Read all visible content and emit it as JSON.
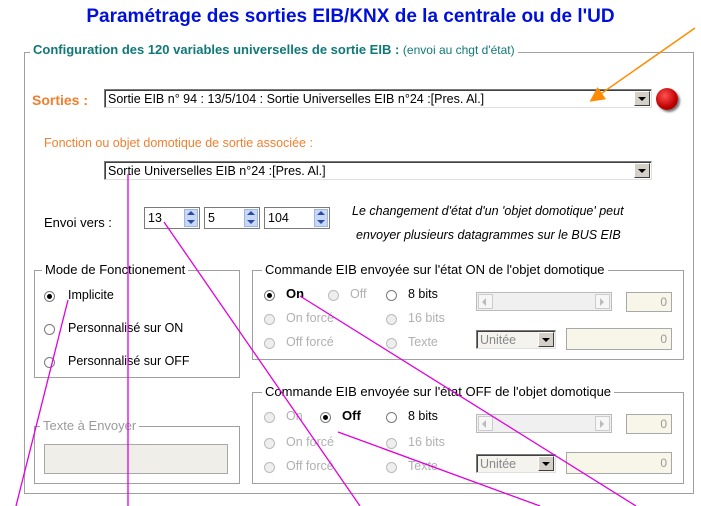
{
  "title": "Paramétrage des sorties EIB/KNX de la centrale ou de l'UD",
  "config": {
    "label": "Configuration des 120 variables universelles de sortie EIB :",
    "note": "(envoi au chgt d'état)"
  },
  "sorties": {
    "label": "Sorties :",
    "value": "Sortie EIB n° 94 : 13/5/104 : Sortie Universelles EIB n°24 :[Pres. Al.]",
    "indicator_color": "#e00000"
  },
  "fonction": {
    "label": "Fonction ou objet domotique de sortie associée :",
    "value": "Sortie Universelles EIB n°24 :[Pres. Al.]"
  },
  "envoi": {
    "label": "Envoi vers :",
    "a": "13",
    "b": "5",
    "c": "104",
    "note1": "Le changement d'état d'un 'objet domotique' peut",
    "note2": "envoyer plusieurs datagrammes sur le BUS EIB"
  },
  "mode": {
    "label": "Mode de Fonctionement",
    "options": [
      "Implicite",
      "Personnalisé sur ON",
      "Personnalisé sur OFF"
    ],
    "selected": 0
  },
  "texte": {
    "label": "Texte à Envoyer",
    "value": ""
  },
  "on_group": {
    "label": "Commande EIB envoyée sur l'état  ON de l'objet domotique",
    "opt_on": "On",
    "opt_off": "Off",
    "opt_8bits": "8 bits",
    "opt_on_force": "On forcé",
    "opt_16bits": "16 bits",
    "opt_off_force": "Off forcé",
    "opt_texte": "Texte",
    "unit": "Unitée",
    "val1": "0",
    "val2": "0"
  },
  "off_group": {
    "label": "Commande EIB envoyée sur l'état  OFF de l'objet domotique",
    "opt_on": "On",
    "opt_off": "Off",
    "opt_8bits": "8 bits",
    "opt_on_force": "On forcé",
    "opt_16bits": "16 bits",
    "opt_off_force": "Off forcé",
    "opt_texte": "Texte",
    "unit": "Unitée",
    "val1": "0",
    "val2": "0"
  },
  "colors": {
    "title": "#0010d8",
    "orange_label": "#f08030",
    "teal_label": "#107878",
    "pointer_lines": "#e000e0",
    "pointer_arrow": "#ff8c00"
  }
}
